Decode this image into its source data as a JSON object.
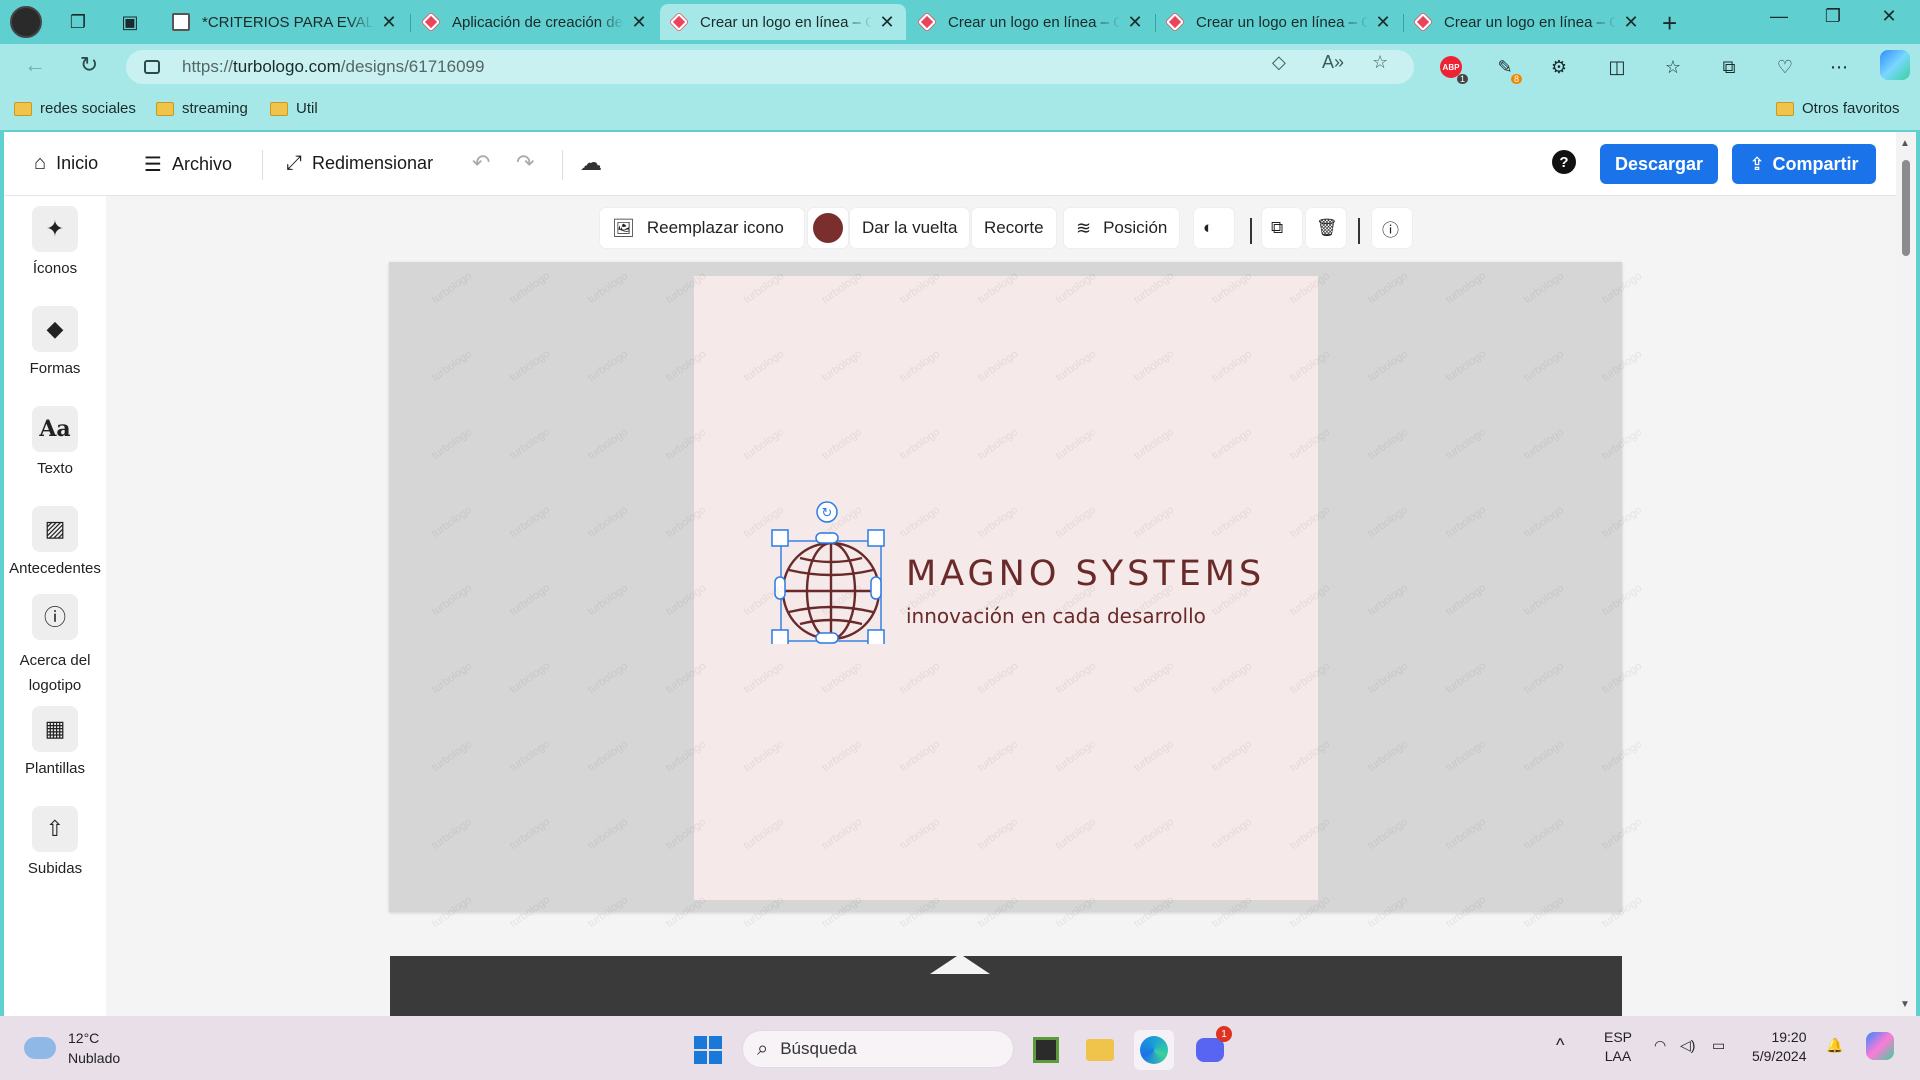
{
  "browser": {
    "tabs": [
      {
        "title": "*CRITERIOS PARA EVALUA",
        "favicon": "document-icon",
        "active": false
      },
      {
        "title": "Aplicación de creación de",
        "favicon": "turbologo-icon",
        "active": false
      },
      {
        "title": "Crear un logo en línea – C",
        "favicon": "turbologo-icon",
        "active": true
      },
      {
        "title": "Crear un logo en línea – C",
        "favicon": "turbologo-icon",
        "active": false
      },
      {
        "title": "Crear un logo en línea – C",
        "favicon": "turbologo-icon",
        "active": false
      },
      {
        "title": "Crear un logo en línea – C",
        "favicon": "turbologo-icon",
        "active": false
      }
    ],
    "url_prefix": "https://",
    "url_domain": "turbologo.com",
    "url_path": "/designs/61716099",
    "extensions": {
      "abp_badge": "1",
      "ext2_badge": "8"
    },
    "favorites": [
      {
        "label": "redes sociales"
      },
      {
        "label": "streaming"
      },
      {
        "label": "Util"
      }
    ],
    "other_favorites": "Otros favoritos"
  },
  "app": {
    "topbar": {
      "home": "Inicio",
      "file": "Archivo",
      "resize": "Redimensionar",
      "download": "Descargar",
      "share": "Compartir"
    },
    "sidebar": [
      {
        "label": "Íconos",
        "icon": "sparkles-icon"
      },
      {
        "label": "Formas",
        "icon": "shapes-icon"
      },
      {
        "label": "Texto",
        "icon": "text-icon"
      },
      {
        "label": "Antecedentes",
        "icon": "background-icon"
      },
      {
        "label": "Acerca del logotipo",
        "icon": "info-icon"
      },
      {
        "label": "Plantillas",
        "icon": "templates-icon"
      },
      {
        "label": "Subidas",
        "icon": "upload-icon"
      }
    ],
    "context_toolbar": {
      "replace_icon": "Reemplazar icono",
      "color": "#7a2e2e",
      "flip": "Dar la vuelta",
      "crop": "Recorte",
      "position": "Posición"
    },
    "logo": {
      "name": "MAGNO SYSTEMS",
      "tagline": "innovación en cada desarrollo",
      "color": "#6a2a2a",
      "background": "#f5e9e9"
    },
    "watermark": "turbologo"
  },
  "taskbar": {
    "temperature": "12°C",
    "condition": "Nublado",
    "search_placeholder": "Búsqueda",
    "lang_1": "ESP",
    "lang_2": "LAA",
    "time": "19:20",
    "date": "5/9/2024",
    "chat_badge": "1"
  }
}
